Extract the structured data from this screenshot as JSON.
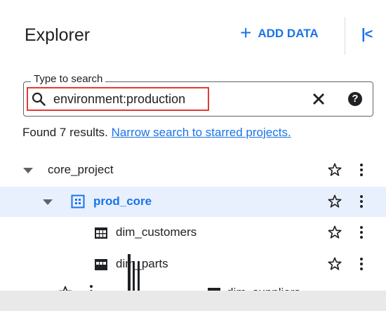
{
  "header": {
    "title": "Explorer",
    "add_data_label": "ADD DATA",
    "collapse_label": "|<"
  },
  "search": {
    "legend": "Type to search",
    "value": "environment:production",
    "help_label": "?"
  },
  "results": {
    "found_text": "Found 7 results.",
    "narrow_link": "Narrow search to starred projects."
  },
  "tree": [
    {
      "label": "core_project",
      "type": "project",
      "level": 0,
      "expanded": true
    },
    {
      "label": "prod_core",
      "type": "dataset",
      "level": 1,
      "expanded": true,
      "selected": true
    },
    {
      "label": "dim_customers",
      "type": "table",
      "level": 2
    },
    {
      "label": "dim_parts",
      "type": "table",
      "level": 2
    },
    {
      "label": "dim_suppliers",
      "type": "table",
      "level": 2
    }
  ],
  "colors": {
    "accent": "#1a73e8",
    "selected_row": "#e8f0fe",
    "highlight_border": "#e53935"
  }
}
